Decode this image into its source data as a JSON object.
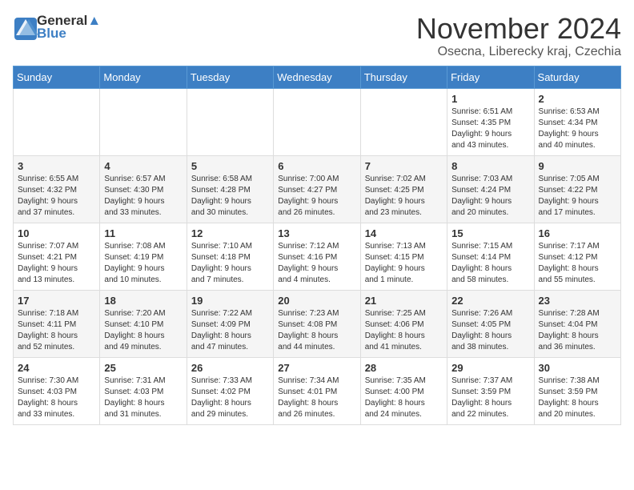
{
  "header": {
    "logo_line1": "General",
    "logo_line2": "Blue",
    "month_title": "November 2024",
    "location": "Osecna, Liberecky kraj, Czechia"
  },
  "weekdays": [
    "Sunday",
    "Monday",
    "Tuesday",
    "Wednesday",
    "Thursday",
    "Friday",
    "Saturday"
  ],
  "weeks": [
    [
      {
        "day": "",
        "info": ""
      },
      {
        "day": "",
        "info": ""
      },
      {
        "day": "",
        "info": ""
      },
      {
        "day": "",
        "info": ""
      },
      {
        "day": "",
        "info": ""
      },
      {
        "day": "1",
        "info": "Sunrise: 6:51 AM\nSunset: 4:35 PM\nDaylight: 9 hours\nand 43 minutes."
      },
      {
        "day": "2",
        "info": "Sunrise: 6:53 AM\nSunset: 4:34 PM\nDaylight: 9 hours\nand 40 minutes."
      }
    ],
    [
      {
        "day": "3",
        "info": "Sunrise: 6:55 AM\nSunset: 4:32 PM\nDaylight: 9 hours\nand 37 minutes."
      },
      {
        "day": "4",
        "info": "Sunrise: 6:57 AM\nSunset: 4:30 PM\nDaylight: 9 hours\nand 33 minutes."
      },
      {
        "day": "5",
        "info": "Sunrise: 6:58 AM\nSunset: 4:28 PM\nDaylight: 9 hours\nand 30 minutes."
      },
      {
        "day": "6",
        "info": "Sunrise: 7:00 AM\nSunset: 4:27 PM\nDaylight: 9 hours\nand 26 minutes."
      },
      {
        "day": "7",
        "info": "Sunrise: 7:02 AM\nSunset: 4:25 PM\nDaylight: 9 hours\nand 23 minutes."
      },
      {
        "day": "8",
        "info": "Sunrise: 7:03 AM\nSunset: 4:24 PM\nDaylight: 9 hours\nand 20 minutes."
      },
      {
        "day": "9",
        "info": "Sunrise: 7:05 AM\nSunset: 4:22 PM\nDaylight: 9 hours\nand 17 minutes."
      }
    ],
    [
      {
        "day": "10",
        "info": "Sunrise: 7:07 AM\nSunset: 4:21 PM\nDaylight: 9 hours\nand 13 minutes."
      },
      {
        "day": "11",
        "info": "Sunrise: 7:08 AM\nSunset: 4:19 PM\nDaylight: 9 hours\nand 10 minutes."
      },
      {
        "day": "12",
        "info": "Sunrise: 7:10 AM\nSunset: 4:18 PM\nDaylight: 9 hours\nand 7 minutes."
      },
      {
        "day": "13",
        "info": "Sunrise: 7:12 AM\nSunset: 4:16 PM\nDaylight: 9 hours\nand 4 minutes."
      },
      {
        "day": "14",
        "info": "Sunrise: 7:13 AM\nSunset: 4:15 PM\nDaylight: 9 hours\nand 1 minute."
      },
      {
        "day": "15",
        "info": "Sunrise: 7:15 AM\nSunset: 4:14 PM\nDaylight: 8 hours\nand 58 minutes."
      },
      {
        "day": "16",
        "info": "Sunrise: 7:17 AM\nSunset: 4:12 PM\nDaylight: 8 hours\nand 55 minutes."
      }
    ],
    [
      {
        "day": "17",
        "info": "Sunrise: 7:18 AM\nSunset: 4:11 PM\nDaylight: 8 hours\nand 52 minutes."
      },
      {
        "day": "18",
        "info": "Sunrise: 7:20 AM\nSunset: 4:10 PM\nDaylight: 8 hours\nand 49 minutes."
      },
      {
        "day": "19",
        "info": "Sunrise: 7:22 AM\nSunset: 4:09 PM\nDaylight: 8 hours\nand 47 minutes."
      },
      {
        "day": "20",
        "info": "Sunrise: 7:23 AM\nSunset: 4:08 PM\nDaylight: 8 hours\nand 44 minutes."
      },
      {
        "day": "21",
        "info": "Sunrise: 7:25 AM\nSunset: 4:06 PM\nDaylight: 8 hours\nand 41 minutes."
      },
      {
        "day": "22",
        "info": "Sunrise: 7:26 AM\nSunset: 4:05 PM\nDaylight: 8 hours\nand 38 minutes."
      },
      {
        "day": "23",
        "info": "Sunrise: 7:28 AM\nSunset: 4:04 PM\nDaylight: 8 hours\nand 36 minutes."
      }
    ],
    [
      {
        "day": "24",
        "info": "Sunrise: 7:30 AM\nSunset: 4:03 PM\nDaylight: 8 hours\nand 33 minutes."
      },
      {
        "day": "25",
        "info": "Sunrise: 7:31 AM\nSunset: 4:03 PM\nDaylight: 8 hours\nand 31 minutes."
      },
      {
        "day": "26",
        "info": "Sunrise: 7:33 AM\nSunset: 4:02 PM\nDaylight: 8 hours\nand 29 minutes."
      },
      {
        "day": "27",
        "info": "Sunrise: 7:34 AM\nSunset: 4:01 PM\nDaylight: 8 hours\nand 26 minutes."
      },
      {
        "day": "28",
        "info": "Sunrise: 7:35 AM\nSunset: 4:00 PM\nDaylight: 8 hours\nand 24 minutes."
      },
      {
        "day": "29",
        "info": "Sunrise: 7:37 AM\nSunset: 3:59 PM\nDaylight: 8 hours\nand 22 minutes."
      },
      {
        "day": "30",
        "info": "Sunrise: 7:38 AM\nSunset: 3:59 PM\nDaylight: 8 hours\nand 20 minutes."
      }
    ]
  ]
}
